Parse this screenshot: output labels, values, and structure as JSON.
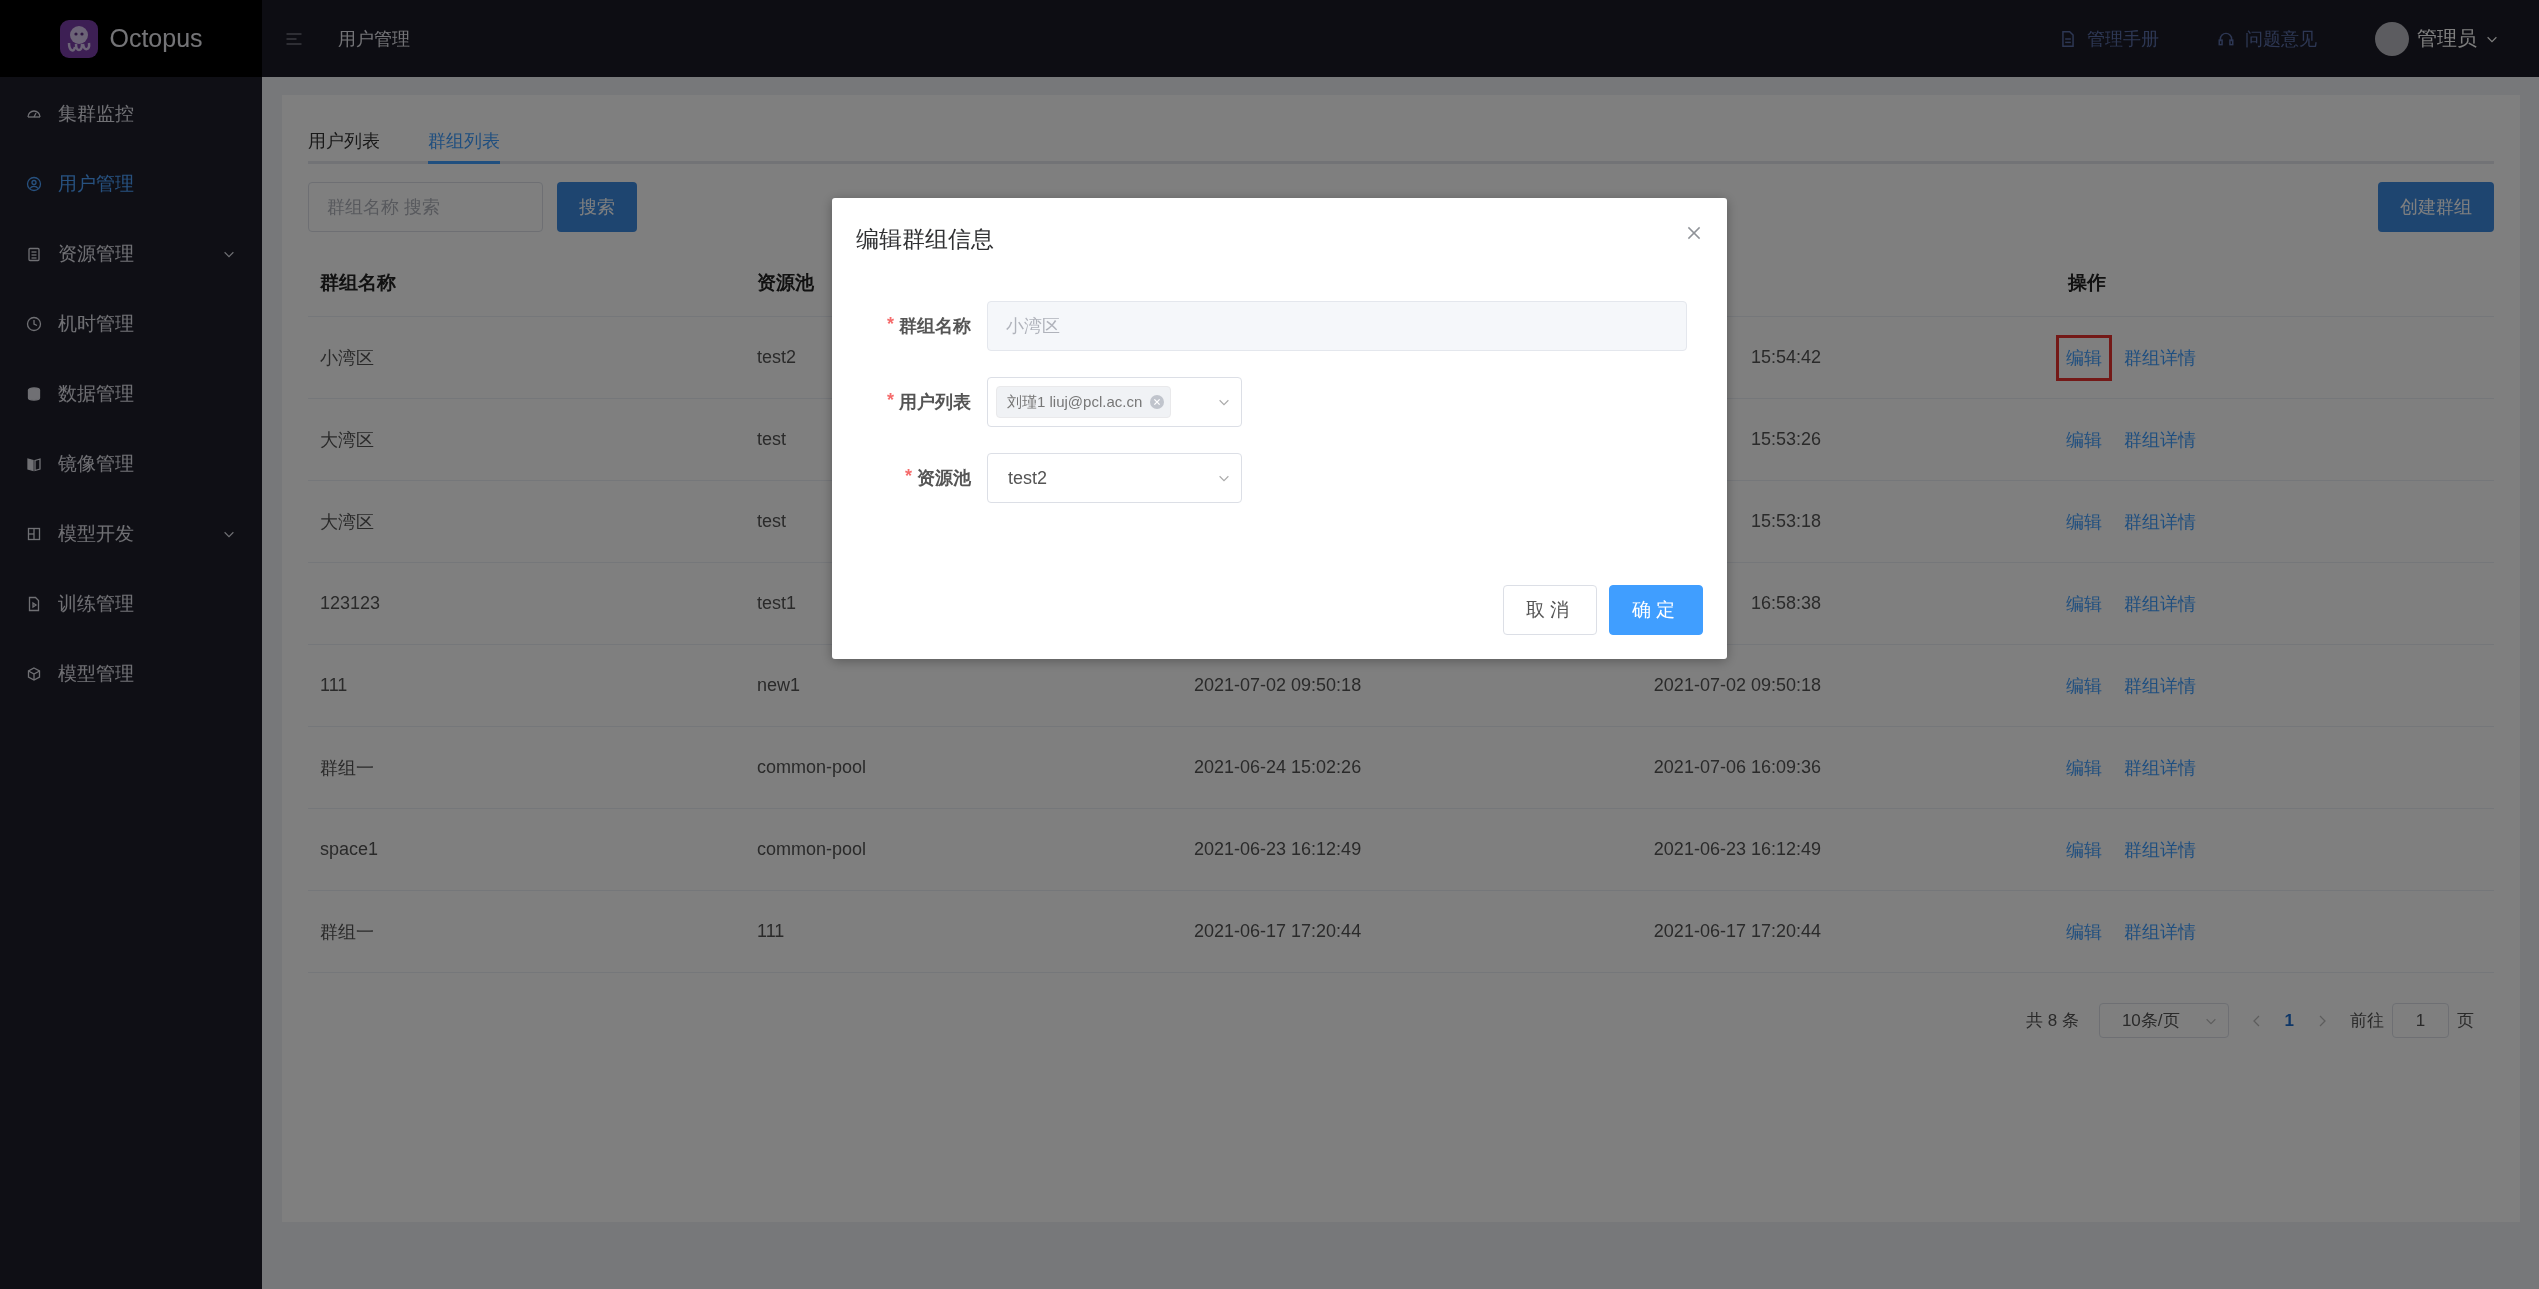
{
  "brand": {
    "name": "Octopus"
  },
  "header": {
    "breadcrumb": "用户管理",
    "links": [
      {
        "label": "管理手册",
        "kind": "doc"
      },
      {
        "label": "问题意见",
        "kind": "headset"
      }
    ],
    "user": "管理员"
  },
  "sidebar": {
    "items": [
      {
        "label": "集群监控",
        "selected": false,
        "expandable": false
      },
      {
        "label": "用户管理",
        "selected": true,
        "expandable": false
      },
      {
        "label": "资源管理",
        "selected": false,
        "expandable": true
      },
      {
        "label": "机时管理",
        "selected": false,
        "expandable": false
      },
      {
        "label": "数据管理",
        "selected": false,
        "expandable": false
      },
      {
        "label": "镜像管理",
        "selected": false,
        "expandable": false
      },
      {
        "label": "模型开发",
        "selected": false,
        "expandable": true
      },
      {
        "label": "训练管理",
        "selected": false,
        "expandable": false
      },
      {
        "label": "模型管理",
        "selected": false,
        "expandable": false
      }
    ]
  },
  "tabs": [
    {
      "label": "用户列表",
      "selected": false
    },
    {
      "label": "群组列表",
      "selected": true
    }
  ],
  "search": {
    "placeholder": "群组名称 搜索",
    "button": "搜索"
  },
  "create_button": "创建群组",
  "table": {
    "columns": {
      "group_name": "群组名称",
      "pool": "资源池",
      "actions": "操作"
    },
    "rows": [
      {
        "group_name": "小湾区",
        "pool": "test2",
        "column_4": "15:54:42",
        "actions": [
          {
            "label": "编辑",
            "highlighted": true
          },
          {
            "label": "群组详情",
            "highlighted": false
          }
        ]
      },
      {
        "group_name": "大湾区",
        "pool": "test",
        "column_4": "15:53:26",
        "actions": [
          {
            "label": "编辑",
            "highlighted": false
          },
          {
            "label": "群组详情",
            "highlighted": false
          }
        ]
      },
      {
        "group_name": "大湾区",
        "pool": "test",
        "column_4": "15:53:18",
        "actions": [
          {
            "label": "编辑",
            "highlighted": false
          },
          {
            "label": "群组详情",
            "highlighted": false
          }
        ]
      },
      {
        "group_name": "123123",
        "pool": "test1",
        "column_4": "16:58:38",
        "actions": [
          {
            "label": "编辑",
            "highlighted": false
          },
          {
            "label": "群组详情",
            "highlighted": false
          }
        ]
      },
      {
        "group_name": "111",
        "pool": "new1",
        "column_3": "2021-07-02 09:50:18",
        "column_4": "2021-07-02 09:50:18",
        "actions": [
          {
            "label": "编辑",
            "highlighted": false
          },
          {
            "label": "群组详情",
            "highlighted": false
          }
        ]
      },
      {
        "group_name": "群组一",
        "pool": "common-pool",
        "column_3": "2021-06-24 15:02:26",
        "column_4": "2021-07-06 16:09:36",
        "actions": [
          {
            "label": "编辑",
            "highlighted": false
          },
          {
            "label": "群组详情",
            "highlighted": false
          }
        ]
      },
      {
        "group_name": "space1",
        "pool": "common-pool",
        "column_3": "2021-06-23 16:12:49",
        "column_4": "2021-06-23 16:12:49",
        "actions": [
          {
            "label": "编辑",
            "highlighted": false
          },
          {
            "label": "群组详情",
            "highlighted": false
          }
        ]
      },
      {
        "group_name": "群组一",
        "pool": "111",
        "column_3": "2021-06-17 17:20:44",
        "column_4": "2021-06-17 17:20:44",
        "actions": [
          {
            "label": "编辑",
            "highlighted": false
          },
          {
            "label": "群组详情",
            "highlighted": false
          }
        ]
      }
    ]
  },
  "pagination": {
    "total": "共 8 条",
    "page_size": "10条/页",
    "pages": [
      {
        "label": "1",
        "selected": true
      }
    ],
    "goto_label": "前往",
    "goto_value": "1",
    "goto_suffix": "页"
  },
  "dialog": {
    "title": "编辑群组信息",
    "fields": [
      {
        "kind": "text",
        "required_mark": "*",
        "label": "群组名称",
        "value": "小湾区",
        "disabled": true
      },
      {
        "kind": "tags",
        "required_mark": "*",
        "label": "用户列表",
        "tags": [
          "刘瑾1 liuj@pcl.ac.cn"
        ]
      },
      {
        "kind": "select",
        "required_mark": "*",
        "label": "资源池",
        "value": "test2"
      }
    ],
    "cancel": "取消",
    "confirm": "确定"
  }
}
